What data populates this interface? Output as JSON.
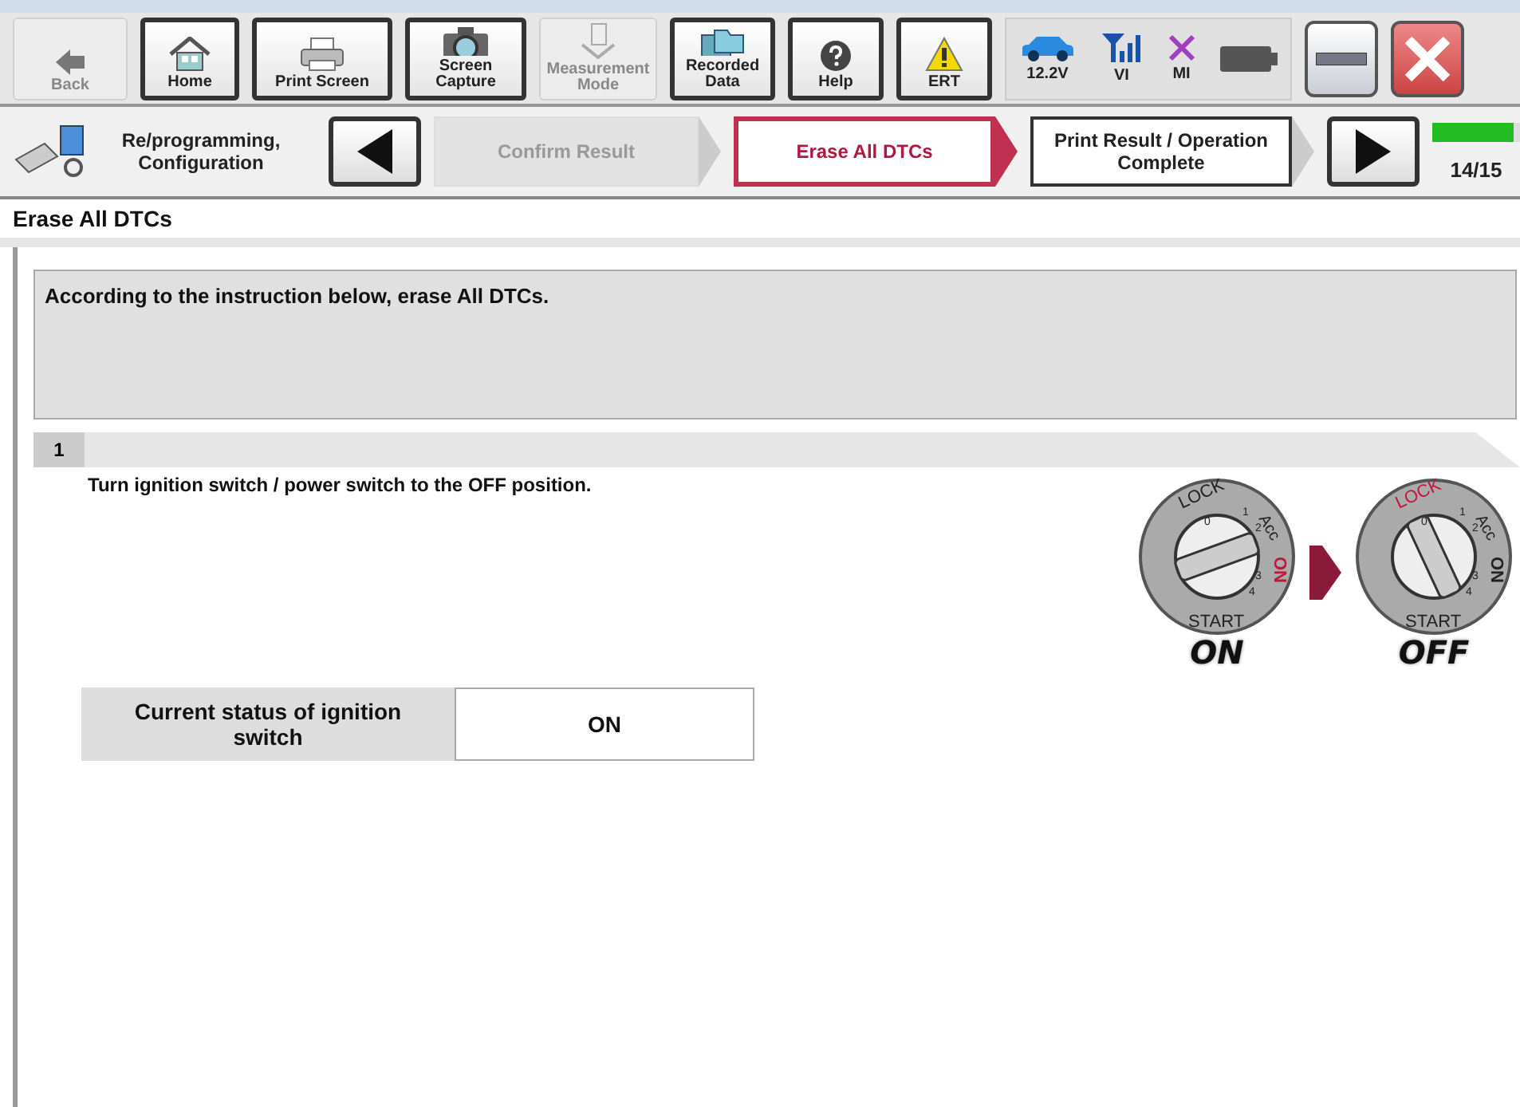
{
  "toolbar": {
    "buttons": [
      {
        "kind": "back",
        "label": "Back",
        "disabled": true
      },
      {
        "kind": "home",
        "label": "Home",
        "disabled": false
      },
      {
        "kind": "print",
        "label": "Print Screen",
        "disabled": false
      },
      {
        "kind": "camera",
        "label": "Screen Capture",
        "disabled": false
      },
      {
        "kind": "measure",
        "label": "Measurement Mode",
        "disabled": true
      },
      {
        "kind": "recorded",
        "label": "Recorded Data",
        "disabled": false
      },
      {
        "kind": "help",
        "label": "Help",
        "disabled": false
      },
      {
        "kind": "ert",
        "label": "ERT",
        "disabled": false
      }
    ],
    "status": [
      {
        "kind": "car",
        "label": "12.2V"
      },
      {
        "kind": "signal",
        "label": "VI"
      },
      {
        "kind": "cross",
        "label": "MI"
      },
      {
        "kind": "battery"
      }
    ]
  },
  "navigation": {
    "section": "Re/programming, Configuration",
    "steps": [
      {
        "label": "Confirm Result",
        "selected": false,
        "disabled": true
      },
      {
        "label": "Erase All DTCs",
        "selected": true,
        "disabled": false
      },
      {
        "label": "Print Result / Operation Complete",
        "selected": false,
        "disabled": false
      }
    ],
    "progress": {
      "level": 0.93,
      "reading": "14/15"
    }
  },
  "page_title": "Erase All DTCs",
  "instruction": "According to the instruction below, erase All DTCs.",
  "step": {
    "number": "1",
    "text": "Turn ignition switch / power switch to the OFF position.",
    "ignition": {
      "dials": [
        {
          "caption": "ON",
          "labels": [
            {
              "kind": "lock",
              "text": "LOCK",
              "highlighted": false
            },
            {
              "kind": "acc",
              "text": "Acc",
              "highlighted": false
            },
            {
              "kind": "on",
              "text": "ON",
              "highlighted": true
            },
            {
              "kind": "start",
              "text": "START",
              "highlighted": false
            }
          ],
          "ticks": [
            "0",
            "1",
            "2",
            "3",
            "4"
          ]
        },
        {
          "caption": "OFF",
          "labels": [
            {
              "kind": "lock",
              "text": "LOCK",
              "highlighted": true
            },
            {
              "kind": "acc",
              "text": "Acc",
              "highlighted": false
            },
            {
              "kind": "on",
              "text": "ON",
              "highlighted": false
            },
            {
              "kind": "start",
              "text": "START",
              "highlighted": false
            }
          ],
          "ticks": [
            "0",
            "1",
            "2",
            "3",
            "4"
          ]
        }
      ]
    },
    "status_table": {
      "label": "Current status of ignition switch",
      "value": "ON"
    }
  }
}
